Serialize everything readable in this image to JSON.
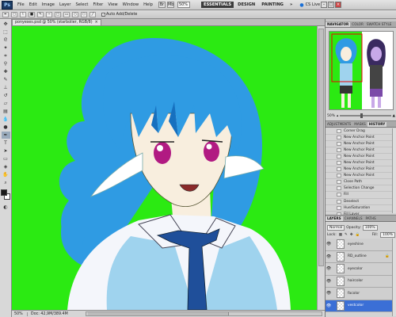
{
  "app": {
    "logo": "Ps"
  },
  "menu": [
    "File",
    "Edit",
    "Image",
    "Layer",
    "Select",
    "Filter",
    "View",
    "Window",
    "Help"
  ],
  "menubar": {
    "mini_icons": [
      "Br",
      "Mb"
    ],
    "zoom": "50%",
    "workspaces": [
      "ESSENTIALS",
      "DESIGN",
      "PAINTING"
    ],
    "more": "»",
    "cs_live": "CS Live",
    "window_buttons": [
      "–",
      "□",
      "×"
    ]
  },
  "options": {
    "auto_add_delete": "Auto Add/Delete",
    "auto_add_checked": "✓"
  },
  "document": {
    "tab_title": "ponyeses.psd @ 50% (starbolier, RGB/8)",
    "tab_close": "×",
    "zoom": "50%",
    "doc_size": "Doc: 42,9M/389.4M"
  },
  "navigator": {
    "tabs": [
      "NAVIGATOR",
      "COLOR",
      "SWATCH STYLE"
    ],
    "zoom": "50%"
  },
  "history": {
    "tabs": [
      "ADJUSTMENTS",
      "MASKS",
      "HISTORY"
    ],
    "items": [
      "Corner Drag",
      "New Anchor Point",
      "New Anchor Point",
      "New Anchor Point",
      "New Anchor Point",
      "New Anchor Point",
      "New Anchor Point",
      "New Anchor Point",
      "Close Path",
      "Selection Change",
      "Fill",
      "Deselect",
      "Hue/Saturation",
      "Fill Layer",
      "Hue/Saturation"
    ],
    "selected_index": 14
  },
  "layers": {
    "tabs": [
      "LAYERS",
      "CHANNELS",
      "PATHS"
    ],
    "blend_mode": "Normal",
    "opacity_label": "Opacity:",
    "opacity": "100%",
    "lock_label": "Lock:",
    "fill_label": "Fill:",
    "fill": "100%",
    "items": [
      {
        "name": "eyeshine"
      },
      {
        "name": "RD_outline",
        "lock": "🔒"
      },
      {
        "name": "eyecolor"
      },
      {
        "name": "haircolor"
      },
      {
        "name": "facolor"
      },
      {
        "name": "vestcolor"
      }
    ],
    "selected_index": 5
  },
  "colors": {
    "canvas_bg": "#2bea12",
    "hair": "#2f9be3",
    "hair_dark": "#1670bf",
    "skin": "#f8eede",
    "shirt": "#f4f6fb",
    "vest": "#9fd3ee",
    "tie": "#1f4f9a",
    "eye": "#b11a82",
    "fg_color": "#1a1a1a",
    "bg_color": "#ffffff",
    "history_selected": "#3b6fd6"
  }
}
